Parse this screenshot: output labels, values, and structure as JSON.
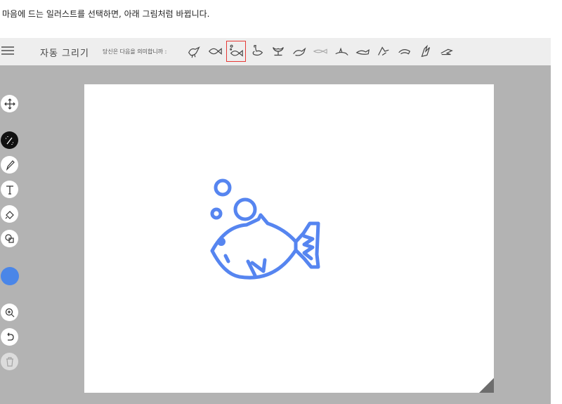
{
  "caption": "마음에 드는 일러스트를 선택하면, 아래 그림처럼 바뀝니다.",
  "app": {
    "title": "자동 그리기",
    "suggest_label": "당신은 다음을 의미합니까 :",
    "choices": [
      {
        "icon": "bird-icon",
        "selected": false
      },
      {
        "icon": "fish-outline-icon",
        "selected": false
      },
      {
        "icon": "fish-bubbles-icon",
        "selected": true
      },
      {
        "icon": "swan-icon",
        "selected": false
      },
      {
        "icon": "whale-tail-icon",
        "selected": false
      },
      {
        "icon": "duck-icon",
        "selected": false
      },
      {
        "icon": "thin-fish-icon",
        "selected": false
      },
      {
        "icon": "shark-icon",
        "selected": false
      },
      {
        "icon": "boat-fish-icon",
        "selected": false
      },
      {
        "icon": "swimmer-icon",
        "selected": false
      },
      {
        "icon": "dolphin-icon",
        "selected": false
      },
      {
        "icon": "bird-flying-icon",
        "selected": false
      },
      {
        "icon": "crocodile-icon",
        "selected": false
      }
    ],
    "tools": [
      {
        "name": "move-tool",
        "icon": "move-icon"
      },
      {
        "name": "autodraw-tool",
        "icon": "magic-pen-icon",
        "active": true
      },
      {
        "name": "draw-tool",
        "icon": "pencil-icon"
      },
      {
        "name": "type-tool",
        "icon": "text-icon"
      },
      {
        "name": "fill-tool",
        "icon": "paint-bucket-icon"
      },
      {
        "name": "shape-tool",
        "icon": "shapes-icon"
      },
      {
        "name": "color-tool",
        "icon": "color-swatch-icon",
        "color": "#4a86e8"
      },
      {
        "name": "zoom-tool",
        "icon": "zoom-in-icon"
      },
      {
        "name": "undo-tool",
        "icon": "undo-icon"
      },
      {
        "name": "delete-tool",
        "icon": "trash-icon",
        "disabled": true
      }
    ],
    "drawing": {
      "icon": "fish-with-bubbles-illustration",
      "stroke_color": "#5685f0"
    }
  }
}
